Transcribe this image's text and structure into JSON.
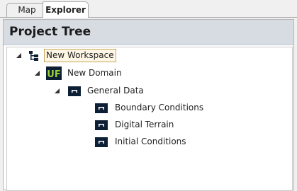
{
  "tabs": [
    {
      "label": "Map"
    },
    {
      "label": "Explorer"
    }
  ],
  "panel": {
    "title": "Project Tree"
  },
  "tree": {
    "workspace": {
      "label": "New Workspace",
      "icon": "workspace-tree-icon"
    },
    "domain": {
      "label": "New Domain",
      "icon": "uf-domain-icon",
      "icon_text": "UF"
    },
    "general": {
      "label": "General Data",
      "icon": "folder-data-icon"
    },
    "items": [
      {
        "label": "Boundary Conditions",
        "icon": "data-item-icon"
      },
      {
        "label": "Digital Terrain",
        "icon": "data-item-icon"
      },
      {
        "label": "Initial Conditions",
        "icon": "data-item-icon"
      }
    ]
  },
  "colors": {
    "header_bg": "#d7dce3",
    "icon_dark": "#0d1f35",
    "uf_green": "#9bd13a",
    "selection_border": "#c9a55a"
  }
}
